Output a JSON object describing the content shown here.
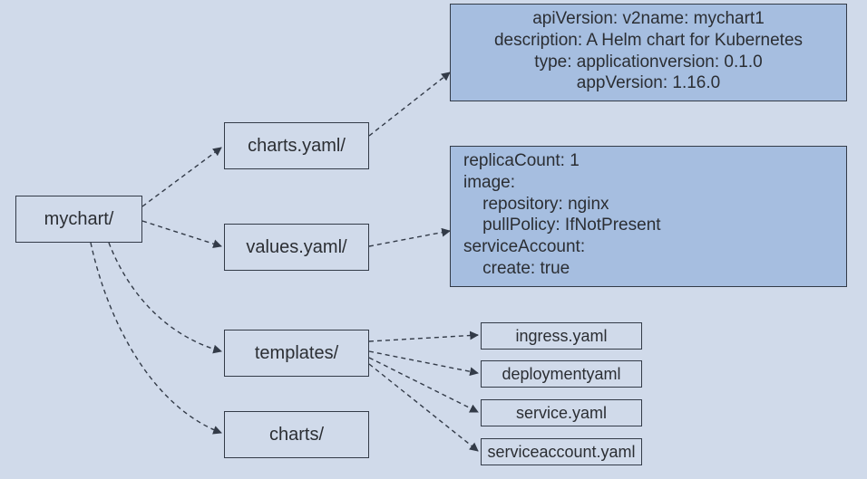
{
  "nodes": {
    "root": {
      "label": "mychart/"
    },
    "charts_yaml": {
      "label": "charts.yaml/"
    },
    "values_yaml": {
      "label": "values.yaml/"
    },
    "templates": {
      "label": "templates/"
    },
    "charts_dir": {
      "label": "charts/"
    },
    "ingress": {
      "label": "ingress.yaml"
    },
    "deployment": {
      "label": "deploymentyaml"
    },
    "service": {
      "label": "service.yaml"
    },
    "svcacct": {
      "label": "serviceaccount.yaml"
    }
  },
  "contents": {
    "chart_yaml": {
      "l1": "apiVersion: v2name: mychart1",
      "l2": "description: A Helm chart for Kubernetes",
      "l3": "type: applicationversion: 0.1.0",
      "l4": "appVersion: 1.16.0"
    },
    "values_yaml": {
      "l1": "replicaCount: 1",
      "l2": "image:",
      "l3": "    repository: nginx",
      "l4": "    pullPolicy: IfNotPresent",
      "l5": "serviceAccount:",
      "l6": "    create: true"
    }
  },
  "chart_data": {
    "type": "diagram-tree",
    "root": "mychart/",
    "children": [
      {
        "name": "charts.yaml/",
        "content": [
          "apiVersion: v2name: mychart1",
          "description: A Helm chart for Kubernetes",
          "type: applicationversion: 0.1.0",
          "appVersion: 1.16.0"
        ]
      },
      {
        "name": "values.yaml/",
        "content": [
          "replicaCount: 1",
          "image:",
          "    repository: nginx",
          "    pullPolicy: IfNotPresent",
          "serviceAccount:",
          "    create: true"
        ]
      },
      {
        "name": "templates/",
        "children": [
          {
            "name": "ingress.yaml"
          },
          {
            "name": "deploymentyaml"
          },
          {
            "name": "service.yaml"
          },
          {
            "name": "serviceaccount.yaml"
          }
        ]
      },
      {
        "name": "charts/"
      }
    ],
    "edge_style": "dashed-arrow"
  }
}
